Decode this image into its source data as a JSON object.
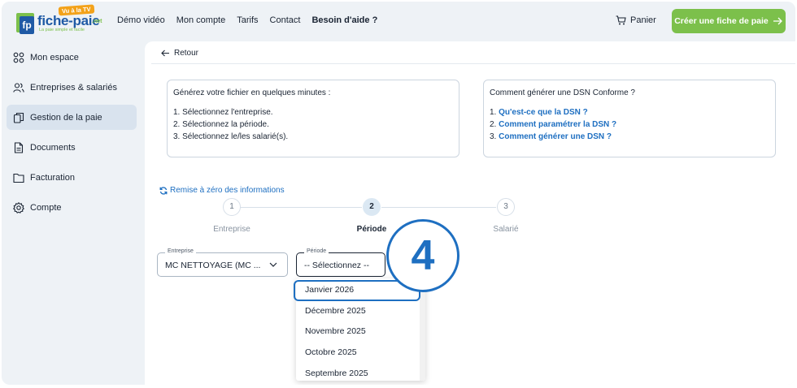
{
  "brand": {
    "badge": "Vu à la TV",
    "name": "fiche-paie",
    "suffix": ".net",
    "monogram": "fp",
    "tagline": "La paie simple et facile"
  },
  "nav": {
    "items": [
      "Démo vidéo",
      "Mon compte",
      "Tarifs",
      "Contact"
    ],
    "help": "Besoin d'aide ?"
  },
  "header": {
    "cart_label": "Panier",
    "cta_label": "Créer une fiche de paie"
  },
  "sidebar": {
    "items": [
      {
        "label": "Mon espace",
        "icon": "grid-icon"
      },
      {
        "label": "Entreprises & salariés",
        "icon": "users-icon"
      },
      {
        "label": "Gestion de la paie",
        "icon": "copy-icon"
      },
      {
        "label": "Documents",
        "icon": "file-icon"
      },
      {
        "label": "Facturation",
        "icon": "folder-icon"
      },
      {
        "label": "Compte",
        "icon": "gear-icon"
      }
    ],
    "active_index": 2
  },
  "main": {
    "back_label": "Retour",
    "info_left": {
      "title": "Générez votre fichier en quelques minutes :",
      "steps": [
        "1. Sélectionnez l'entreprise.",
        "2. Sélectionnez la période.",
        "3. Sélectionnez le/les salarié(s)."
      ]
    },
    "info_right": {
      "title": "Comment générer une DSN Conforme ?",
      "links": [
        {
          "num": "1.",
          "text": "Qu'est-ce que la DSN ?"
        },
        {
          "num": "2.",
          "text": "Comment paramétrer la DSN ?"
        },
        {
          "num": "3.",
          "text": "Comment générer une DSN ?"
        }
      ]
    },
    "reset_label": "Remise à zéro des informations",
    "stepper": [
      {
        "num": "1",
        "label": "Entreprise"
      },
      {
        "num": "2",
        "label": "Période"
      },
      {
        "num": "3",
        "label": "Salarié"
      }
    ],
    "active_step": 2,
    "company_field": {
      "legend": "Entreprise",
      "value": "MC NETTOYAGE (MC ..."
    },
    "period_field": {
      "legend": "Période",
      "value": "-- Sélectionnez --"
    },
    "period_options": [
      "Janvier 2026",
      "Décembre 2025",
      "Novembre 2025",
      "Octobre 2025",
      "Septembre 2025"
    ],
    "highlighted_option_index": 0
  },
  "annotation": {
    "step_number": "4",
    "color": "#1e6fc1"
  }
}
